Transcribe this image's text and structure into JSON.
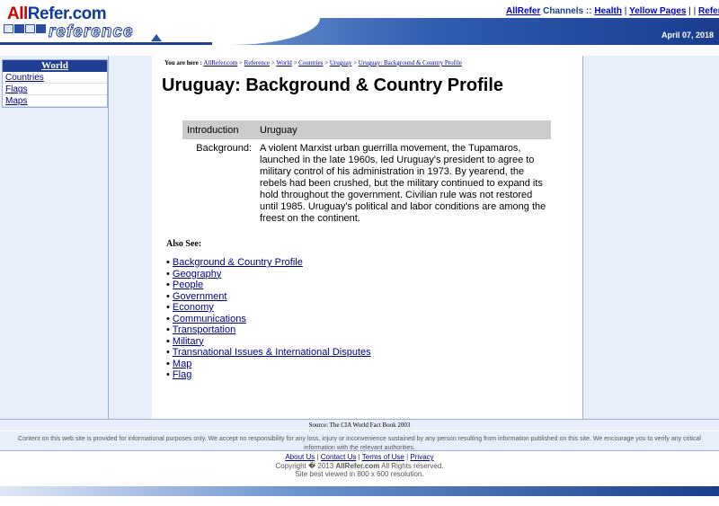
{
  "logo": {
    "top_part1": "All",
    "top_part2": "Refer.com",
    "bottom": "reference"
  },
  "channels": {
    "brand": "AllRefer",
    "label": "Channels ::",
    "links": [
      "Health",
      "Yellow Pages",
      "Reference"
    ],
    "sep1": "|",
    "sep2": "| |"
  },
  "header": {
    "date": "April 07, 2018"
  },
  "sidebar": {
    "title": "World",
    "items": [
      {
        "label": "Countries"
      },
      {
        "label": "Flags"
      },
      {
        "label": "Maps"
      }
    ]
  },
  "breadcrumb": {
    "prefix": "You are here :",
    "items": [
      "AllRefer.com",
      "Reference",
      "World",
      "Countries",
      "Uruguay",
      "Uruguay: Background & Country Profile"
    ],
    "separator": ">"
  },
  "main": {
    "title": "Uruguay: Background & Country Profile",
    "table": {
      "head_label": "Introduction",
      "head_value": "Uruguay",
      "row_label": "Background:",
      "row_value": "A violent Marxist urban guerrilla movement, the Tupamaros, launched in the late 1960s, led Uruguay's president to agree to military control of his administration in 1973. By yearend, the rebels had been crushed, but the military continued to expand its hold throughout the government. Civilian rule was not restored until 1985. Uruguay's political and labor conditions are among the freest on the continent."
    },
    "also_see_heading": "Also See:",
    "also_see": [
      "Background & Country Profile",
      "Geography",
      "People",
      "Government",
      "Economy",
      "Communications",
      "Transportation",
      "Military",
      "Transnational Issues & International Disputes",
      "Map",
      "Flag"
    ]
  },
  "footer": {
    "source": "Source: The CIA World Fact Book 2003",
    "disclaimer": "Content on this web site is provided for informational purposes only. We accept no responsibility for any loss, injury or inconvenience sustained by any person resulting from information published on this site. We encourage you to verify any critical information with the relevant authorities.",
    "links": [
      "About Us",
      "Contact Us",
      "Terms of Use",
      "Privacy"
    ],
    "link_sep": "|",
    "copyright_prefix": "Copyright � 2013",
    "copyright_brand": "AllRefer.com",
    "copyright_suffix": "All Rights reserved.",
    "best_viewed": "Site best viewed in 800 x 600 resolution."
  },
  "colors": {
    "brand_blue": "#1f3f94",
    "brand_red": "#d10000",
    "panel_bg": "#e8eefa",
    "table_head_bg": "#cccccc"
  }
}
